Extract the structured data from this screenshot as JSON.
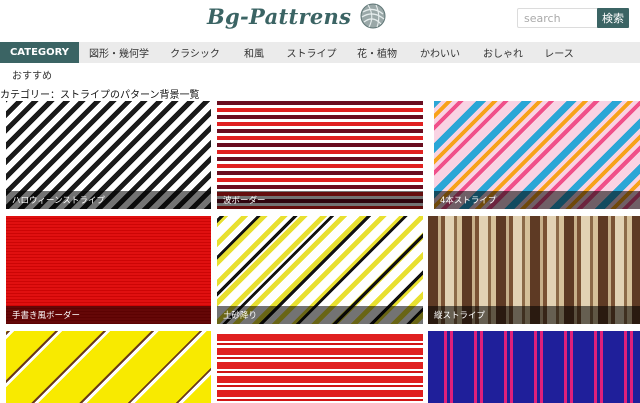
{
  "header": {
    "logo_text": "Bg-Pattrens",
    "logo_mark_icon": "yarn-ball-icon",
    "search": {
      "placeholder": "search",
      "value": ""
    },
    "search_button_label": "検索"
  },
  "nav": {
    "items": [
      {
        "label": "CATEGORY",
        "active": true
      },
      {
        "label": "図形・幾何学"
      },
      {
        "label": "クラシック"
      },
      {
        "label": "和風"
      },
      {
        "label": "ストライプ"
      },
      {
        "label": "花・植物"
      },
      {
        "label": "かわいい"
      },
      {
        "label": "おしゃれ"
      },
      {
        "label": "レース"
      }
    ],
    "sub_label": "おすすめ"
  },
  "page_title": "カテゴリー：ストライプのパターン背景一覧",
  "tiles": [
    {
      "caption": "ハロウィーンストライプ"
    },
    {
      "caption": "波ボーダー"
    },
    {
      "caption": "4本ストライプ"
    },
    {
      "caption": "手書き風ボーダー"
    },
    {
      "caption": "土砂降り"
    },
    {
      "caption": "縦ストライプ"
    },
    {
      "caption": ""
    },
    {
      "caption": ""
    },
    {
      "caption": ""
    }
  ],
  "colors": {
    "brand": "#3b6464",
    "nav_bg": "#ebebeb"
  }
}
